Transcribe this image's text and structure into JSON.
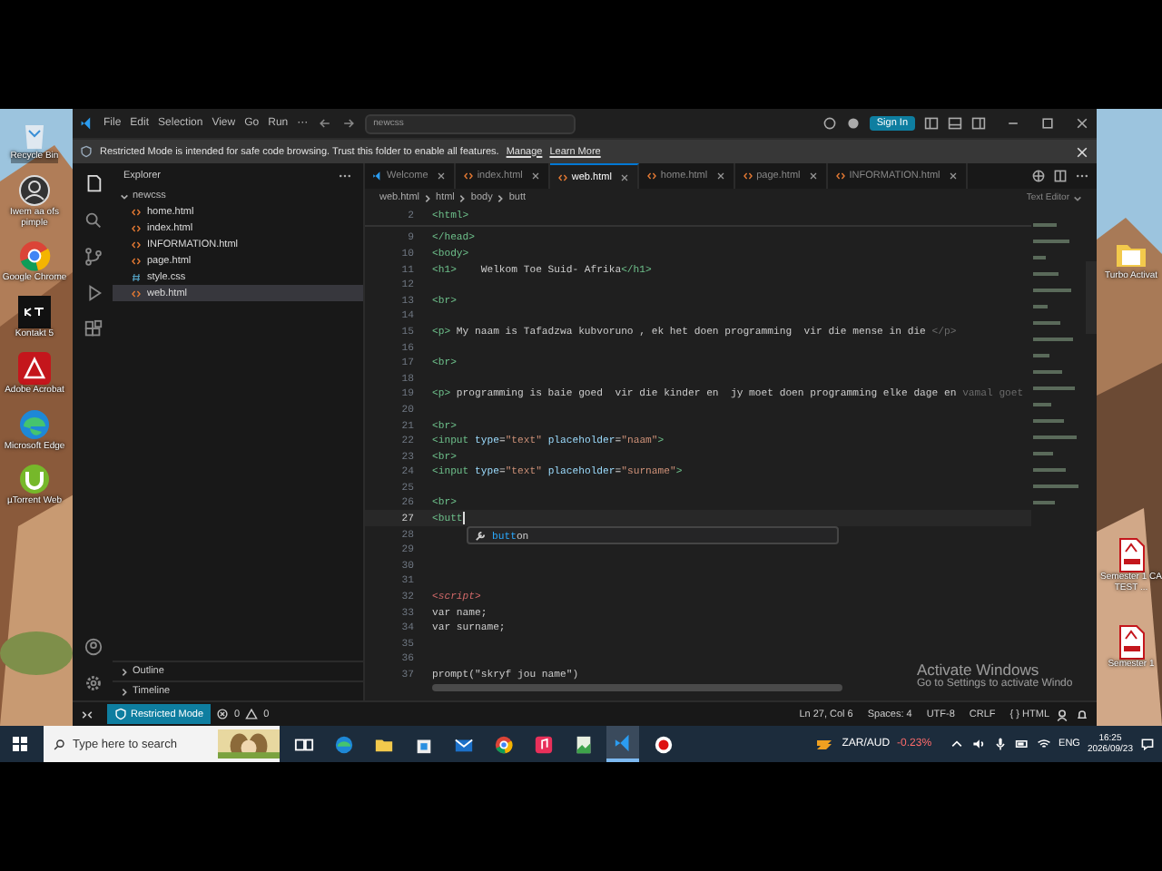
{
  "desktop_icons_left": [
    {
      "kind": "recycle",
      "label": "Recycle Bin"
    },
    {
      "kind": "person",
      "label": "Iwem aa ofs pimple"
    },
    {
      "kind": "chrome",
      "label": "Google Chrome"
    },
    {
      "kind": "kontakt",
      "label": "Kontakt 5"
    },
    {
      "kind": "acrobat",
      "label": "Adobe Acrobat"
    },
    {
      "kind": "edge",
      "label": "Microsoft Edge"
    },
    {
      "kind": "utorrent",
      "label": "µTorrent Web"
    }
  ],
  "desktop_icons_right": [
    {
      "kind": "folder",
      "label": "Turbo Activat"
    },
    {
      "kind": "pdf",
      "label": "Semester 1 CA TEST ..."
    },
    {
      "kind": "pdf",
      "label": "Semester 1"
    }
  ],
  "window": {
    "menu": [
      "File",
      "Edit",
      "Selection",
      "View",
      "Go",
      "Run",
      "···"
    ],
    "command_center": "newcss",
    "sign_in": "Sign In"
  },
  "notification": {
    "text": "Restricted Mode is intended for safe code browsing. Trust this folder to enable all features.",
    "links": [
      "Manage",
      "Learn More"
    ]
  },
  "sidebar": {
    "title": "Explorer",
    "folder": {
      "name": "newcss",
      "expanded": true,
      "children": [
        {
          "name": "home.html",
          "kind": "html",
          "selected": false
        },
        {
          "name": "index.html",
          "kind": "html",
          "selected": false
        },
        {
          "name": "INFORMATION.html",
          "kind": "html",
          "selected": false
        },
        {
          "name": "page.html",
          "kind": "html",
          "selected": false
        },
        {
          "name": "style.css",
          "kind": "css",
          "selected": false
        },
        {
          "name": "web.html",
          "kind": "html",
          "selected": true
        }
      ]
    },
    "sections": [
      {
        "name": "Outline",
        "expanded": false
      },
      {
        "name": "Timeline",
        "expanded": false
      }
    ]
  },
  "tabs": [
    {
      "label": "Welcome",
      "kind": "welcome",
      "selected": false
    },
    {
      "label": "index.html",
      "kind": "html",
      "selected": false
    },
    {
      "label": "web.html",
      "kind": "html",
      "selected": true
    },
    {
      "label": "home.html",
      "kind": "html",
      "selected": false
    },
    {
      "label": "page.html",
      "kind": "html",
      "selected": false
    },
    {
      "label": "INFORMATION.html",
      "kind": "html",
      "selected": false
    }
  ],
  "breadcrumbs": [
    "web.html",
    "html",
    "body",
    "butt"
  ],
  "editor_mode": "Text Editor",
  "sticky_lines": [
    {
      "number": "2",
      "parts": [
        {
          "kind": "tag",
          "text": "<html>"
        }
      ]
    }
  ],
  "lines": [
    {
      "number": "9",
      "parts": [
        {
          "kind": "tag",
          "text": "</head>"
        }
      ]
    },
    {
      "number": "10",
      "parts": [
        {
          "kind": "tag",
          "text": "<body>"
        }
      ]
    },
    {
      "number": "11",
      "parts": [
        {
          "kind": "tag",
          "text": "<h1>"
        },
        {
          "kind": "text",
          "text": "    Welkom Toe Suid- Afrika"
        },
        {
          "kind": "tag",
          "text": "</h1>"
        }
      ]
    },
    {
      "number": "12"
    },
    {
      "number": "13",
      "parts": [
        {
          "kind": "tag",
          "text": "<br>"
        }
      ]
    },
    {
      "number": "14"
    },
    {
      "number": "15",
      "parts": [
        {
          "kind": "tag",
          "text": "<p>"
        },
        {
          "kind": "text",
          "text": " My naam is Tafadzwa kubvoruno , ek het doen programming  vir die mense in die "
        },
        {
          "kind": "faded",
          "text": "</p>"
        }
      ]
    },
    {
      "number": "16"
    },
    {
      "number": "17",
      "parts": [
        {
          "kind": "tag",
          "text": "<br>"
        }
      ]
    },
    {
      "number": "18"
    },
    {
      "number": "19",
      "parts": [
        {
          "kind": "tag",
          "text": "<p>"
        },
        {
          "kind": "text",
          "text": " programming is baie goed  vir die kinder en  jy moet doen programming elke dage en "
        },
        {
          "kind": "faded",
          "text": "vamal goet"
        }
      ]
    },
    {
      "number": "20"
    },
    {
      "number": "21",
      "parts": [
        {
          "kind": "tag",
          "text": "<br>"
        }
      ]
    },
    {
      "number": "22",
      "parts": [
        {
          "kind": "tag",
          "text": "<input"
        },
        {
          "kind": "attr",
          "text": " type"
        },
        {
          "kind": "text",
          "text": "="
        },
        {
          "kind": "string",
          "text": "\"text\""
        },
        {
          "kind": "attr",
          "text": " placeholder"
        },
        {
          "kind": "text",
          "text": "="
        },
        {
          "kind": "string",
          "text": "\"naam\""
        },
        {
          "kind": "tag",
          "text": ">"
        }
      ]
    },
    {
      "number": "23",
      "parts": [
        {
          "kind": "tag",
          "text": "<br>"
        }
      ]
    },
    {
      "number": "24",
      "parts": [
        {
          "kind": "tag",
          "text": "<input"
        },
        {
          "kind": "attr",
          "text": " type"
        },
        {
          "kind": "text",
          "text": "="
        },
        {
          "kind": "string",
          "text": "\"text\""
        },
        {
          "kind": "attr",
          "text": " placeholder"
        },
        {
          "kind": "text",
          "text": "="
        },
        {
          "kind": "string",
          "text": "\"surname\""
        },
        {
          "kind": "tag",
          "text": ">"
        }
      ]
    },
    {
      "number": "25"
    },
    {
      "number": "26",
      "parts": [
        {
          "kind": "tag",
          "text": "<br>"
        }
      ]
    },
    {
      "number": "27",
      "current": true,
      "parts": [
        {
          "kind": "tag",
          "text": "<butt"
        }
      ]
    },
    {
      "number": "28"
    },
    {
      "number": "29"
    },
    {
      "number": "30"
    },
    {
      "number": "31"
    },
    {
      "number": "32",
      "parts": [
        {
          "kind": "script",
          "text": "<script>"
        }
      ]
    },
    {
      "number": "33",
      "parts": [
        {
          "kind": "text",
          "text": "var name;"
        }
      ]
    },
    {
      "number": "34",
      "parts": [
        {
          "kind": "text",
          "text": "var surname;"
        }
      ]
    },
    {
      "number": "35"
    },
    {
      "number": "36"
    },
    {
      "number": "37",
      "parts": [
        {
          "kind": "text",
          "text": "prompt(\"skryf jou name\")"
        }
      ]
    }
  ],
  "suggestion": "**butt**on",
  "status_bar": {
    "mode": "Restricted Mode",
    "errors": "0",
    "warnings": "0",
    "items": [
      "Ln 27, Col 6",
      "Spaces: 4",
      "UTF-8",
      "CRLF",
      "{ } HTML"
    ]
  },
  "activation": {
    "title": "Activate Windows",
    "text": "Go to Settings to activate Windo"
  },
  "taskbar": {
    "search_placeholder": "Type here to search",
    "apps": [
      {
        "kind": "taskview",
        "active": false
      },
      {
        "kind": "edge",
        "active": false
      },
      {
        "kind": "explorer",
        "active": false
      },
      {
        "kind": "store",
        "active": false
      },
      {
        "kind": "mail",
        "active": false
      },
      {
        "kind": "chrome",
        "active": false
      },
      {
        "kind": "music",
        "active": false
      },
      {
        "kind": "photos",
        "active": false
      },
      {
        "kind": "vscode",
        "active": true
      },
      {
        "kind": "record",
        "active": false
      }
    ],
    "ticker": "ZAR/AUD",
    "change": "-0.23%",
    "language": "ENG",
    "time": "16:25",
    "date": "2026/09/23"
  }
}
